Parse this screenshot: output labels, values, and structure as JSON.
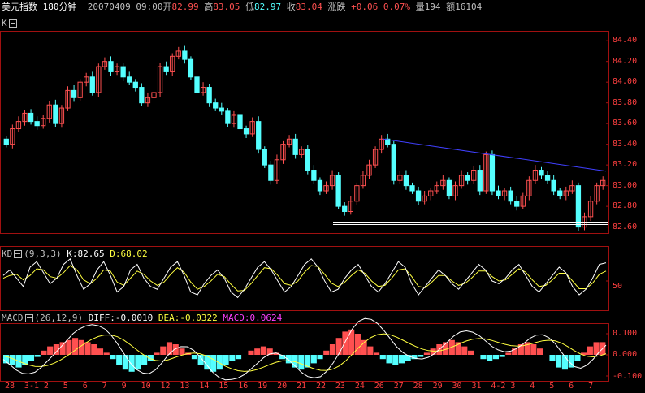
{
  "header": {
    "instrument": "美元指数",
    "period": "180分钟",
    "datetime": "20070409 09:00",
    "open_label": "开",
    "open": "82.99",
    "high_label": "高",
    "high": "83.05",
    "low_label": "低",
    "low": "82.97",
    "close_label": "收",
    "close": "83.04",
    "change_label": "涨跌",
    "change": "+0.06",
    "change_pct": "0.07%",
    "volume_label": "量",
    "volume": "194",
    "amount_label": "额",
    "amount": "16104"
  },
  "main_panel": {
    "label": "K",
    "yticks": [
      "84.40",
      "84.20",
      "84.00",
      "83.80",
      "83.60",
      "83.40",
      "83.20",
      "83.00",
      "82.80",
      "82.60"
    ],
    "ylim": [
      82.55,
      84.48
    ]
  },
  "kd_panel": {
    "label": "KD",
    "params": "(9,3,3)",
    "k_label": "K:",
    "k": "82.65",
    "d_label": "D:",
    "d": "68.02",
    "ytick": "50"
  },
  "macd_panel": {
    "label": "MACD",
    "params": "(26,12,9)",
    "diff_label": "DIFF:",
    "diff": "-0.0010",
    "dea_label": "DEA:",
    "dea": "-0.0322",
    "macd_label": "MACD:",
    "macd": "0.0624",
    "yticks": [
      "0.100",
      "0.000",
      "-0.100"
    ]
  },
  "x_axis": {
    "ticks": [
      "28",
      "3-1",
      "2",
      "5",
      "6",
      "7",
      "9",
      "10",
      "12",
      "13",
      "14",
      "15",
      "16",
      "19",
      "20",
      "21",
      "22",
      "23",
      "24",
      "26",
      "27",
      "28",
      "29",
      "30",
      "31",
      "4-2",
      "3",
      "4",
      "5",
      "6",
      "7"
    ]
  },
  "colors": {
    "up": "#ff5050",
    "down": "#54ffff",
    "grid": "#a01010",
    "trendline": "#4040ff",
    "support": "#ffffff",
    "kd_k": "#ffffff",
    "kd_d": "#ffff40"
  },
  "chart_data": {
    "type": "candlestick",
    "ylim": [
      82.55,
      84.48
    ],
    "support_level": 82.64,
    "trendline": {
      "start": 83.45,
      "end": 83.14
    },
    "closes": [
      83.4,
      83.55,
      83.62,
      83.7,
      83.62,
      83.58,
      83.65,
      83.78,
      83.6,
      83.75,
      83.92,
      83.85,
      84.0,
      84.05,
      83.9,
      84.15,
      84.2,
      84.1,
      84.15,
      84.05,
      84.0,
      83.95,
      83.8,
      83.85,
      83.9,
      84.15,
      84.1,
      84.25,
      84.3,
      84.22,
      84.05,
      83.9,
      83.95,
      83.8,
      83.75,
      83.72,
      83.6,
      83.68,
      83.55,
      83.5,
      83.62,
      83.35,
      83.2,
      83.05,
      83.25,
      83.4,
      83.45,
      83.3,
      83.35,
      83.15,
      83.05,
      82.95,
      83.0,
      83.1,
      82.8,
      82.75,
      82.85,
      83.0,
      83.1,
      83.2,
      83.35,
      83.45,
      83.4,
      83.05,
      83.1,
      83.0,
      82.95,
      82.85,
      82.9,
      82.95,
      83.0,
      83.05,
      82.9,
      83.0,
      83.1,
      83.05,
      83.15,
      82.95,
      83.3,
      82.95,
      82.9,
      82.95,
      82.85,
      82.8,
      82.9,
      83.05,
      83.15,
      83.1,
      83.05,
      82.95,
      82.9,
      82.95,
      83.0,
      82.6,
      82.7,
      82.85,
      83.0,
      83.05
    ],
    "kd": {
      "k": [
        60,
        70,
        55,
        40,
        75,
        85,
        65,
        45,
        55,
        80,
        90,
        60,
        35,
        45,
        70,
        85,
        60,
        30,
        40,
        70,
        80,
        55,
        40,
        35,
        55,
        75,
        85,
        60,
        30,
        25,
        45,
        60,
        70,
        55,
        30,
        20,
        35,
        55,
        75,
        85,
        70,
        50,
        30,
        40,
        60,
        80,
        90,
        75,
        50,
        30,
        35,
        55,
        70,
        80,
        60,
        40,
        30,
        45,
        65,
        85,
        75,
        45,
        25,
        40,
        55,
        70,
        60,
        45,
        35,
        50,
        65,
        80,
        70,
        50,
        45,
        55,
        70,
        80,
        60,
        40,
        30,
        45,
        60,
        75,
        65,
        40,
        25,
        35,
        55,
        80,
        83
      ],
      "d": [
        55,
        60,
        62,
        52,
        60,
        72,
        70,
        58,
        55,
        65,
        78,
        70,
        52,
        45,
        55,
        70,
        68,
        48,
        42,
        55,
        68,
        62,
        50,
        42,
        48,
        62,
        74,
        66,
        48,
        35,
        40,
        50,
        62,
        58,
        44,
        32,
        33,
        45,
        60,
        74,
        72,
        60,
        45,
        42,
        50,
        66,
        78,
        76,
        62,
        46,
        40,
        48,
        60,
        70,
        64,
        50,
        40,
        42,
        55,
        70,
        72,
        58,
        40,
        38,
        48,
        60,
        60,
        50,
        42,
        46,
        56,
        68,
        68,
        58,
        50,
        52,
        62,
        72,
        66,
        52,
        40,
        42,
        52,
        64,
        64,
        50,
        36,
        36,
        46,
        62,
        68
      ]
    },
    "macd": {
      "hist": [
        -0.04,
        -0.05,
        -0.06,
        -0.05,
        -0.03,
        -0.01,
        0.02,
        0.04,
        0.05,
        0.06,
        0.07,
        0.08,
        0.07,
        0.06,
        0.05,
        0.03,
        0.01,
        -0.02,
        -0.05,
        -0.07,
        -0.08,
        -0.07,
        -0.05,
        -0.03,
        0.01,
        0.04,
        0.06,
        0.05,
        0.03,
        0.01,
        -0.02,
        -0.05,
        -0.07,
        -0.08,
        -0.07,
        -0.05,
        -0.03,
        -0.02,
        0.0,
        0.02,
        0.03,
        0.04,
        0.03,
        0.01,
        -0.02,
        -0.04,
        -0.06,
        -0.07,
        -0.06,
        -0.04,
        -0.02,
        0.02,
        0.05,
        0.08,
        0.11,
        0.12,
        0.1,
        0.07,
        0.04,
        0.01,
        -0.02,
        -0.04,
        -0.05,
        -0.04,
        -0.03,
        -0.02,
        -0.01,
        0.01,
        0.03,
        0.05,
        0.06,
        0.07,
        0.06,
        0.04,
        0.02,
        0.0,
        -0.02,
        -0.03,
        -0.02,
        -0.01,
        0.01,
        0.03,
        0.05,
        0.06,
        0.05,
        0.03,
        0.0,
        -0.03,
        -0.06,
        -0.07,
        -0.06,
        -0.03,
        0.01,
        0.04,
        0.06,
        0.06
      ]
    }
  }
}
